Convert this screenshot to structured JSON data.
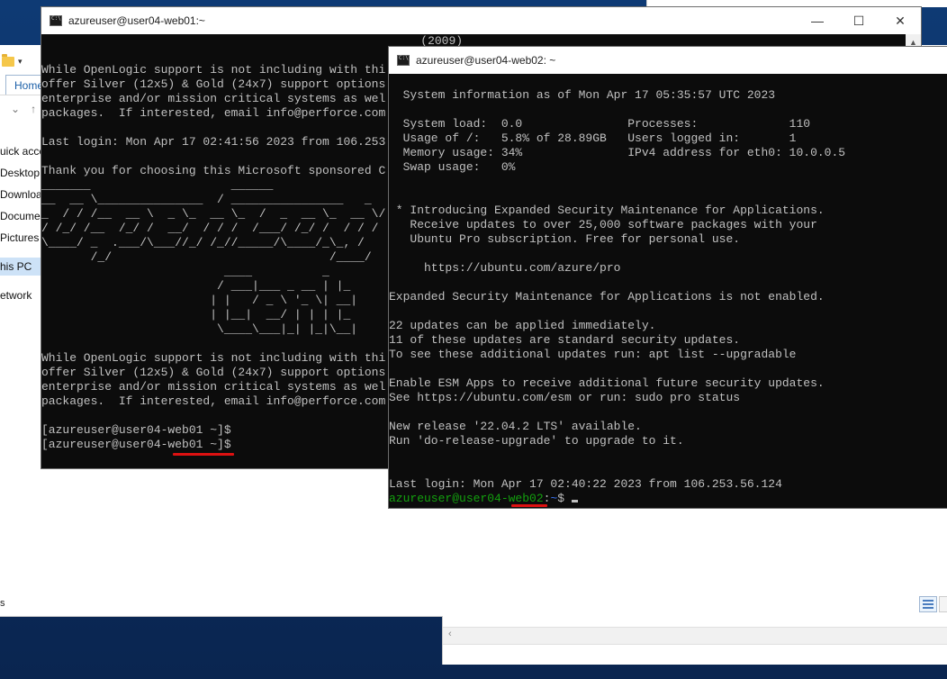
{
  "explorer": {
    "home_tab": "Home",
    "nav_items": [
      "uick acce",
      "Desktop",
      "Downloa",
      "Docume",
      "Pictures",
      "his PC",
      "etwork"
    ],
    "status_text": "s"
  },
  "web01": {
    "title": "azureuser@user04-web01:~",
    "lines": [
      "                                                      (2009)",
      "",
      "While OpenLogic support is not including with thi",
      "offer Silver (12x5) & Gold (24x7) support options",
      "enterprise and/or mission critical systems as wel",
      "packages.  If interested, email info@perforce.com",
      "",
      "Last login: Mon Apr 17 02:41:56 2023 from 106.253",
      "",
      "Thank you for choosing this Microsoft sponsored C",
      "_______                    ______               ",
      "__  __ \\_______________  / ________________   _",
      "_  / / /__  __ \\  _ \\_  __ \\_  /  _  __ \\_  __ \\/",
      "/ /_/ /__  /_/ /  __/  / / /  /___/ /_/ /  / / /",
      "\\____/ _  .___/\\___//_/ /_//_____/\\____/_\\_, /",
      "       /_/                               /____/ ",
      "                          ____          _     ",
      "                         / ___|___ _ __ | |_ ",
      "                        | |   / _ \\ '_ \\| __|",
      "                        | |__|  __/ | | | |_ ",
      "                         \\____\\___|_| |_|\\__|",
      "",
      "While OpenLogic support is not including with thi",
      "offer Silver (12x5) & Gold (24x7) support options",
      "enterprise and/or mission critical systems as wel",
      "packages.  If interested, email info@perforce.com",
      "",
      "[azureuser@user04-web01 ~]$",
      "[azureuser@user04-web01 ~]$"
    ]
  },
  "web02": {
    "title": "azureuser@user04-web02: ~",
    "lines": [
      "",
      "  System information as of Mon Apr 17 05:35:57 UTC 2023",
      "",
      "  System load:  0.0               Processes:             110",
      "  Usage of /:   5.8% of 28.89GB   Users logged in:       1",
      "  Memory usage: 34%               IPv4 address for eth0: 10.0.0.5",
      "  Swap usage:   0%",
      "",
      "",
      " * Introducing Expanded Security Maintenance for Applications.",
      "   Receive updates to over 25,000 software packages with your",
      "   Ubuntu Pro subscription. Free for personal use.",
      "",
      "     https://ubuntu.com/azure/pro",
      "",
      "Expanded Security Maintenance for Applications is not enabled.",
      "",
      "22 updates can be applied immediately.",
      "11 of these updates are standard security updates.",
      "To see these additional updates run: apt list --upgradable",
      "",
      "Enable ESM Apps to receive additional future security updates.",
      "See https://ubuntu.com/esm or run: sudo pro status",
      "",
      "New release '22.04.2 LTS' available.",
      "Run 'do-release-upgrade' to upgrade to it.",
      "",
      "",
      "Last login: Mon Apr 17 02:40:22 2023 from 106.253.56.124"
    ],
    "prompt_user": "azureuser@user04-web02",
    "prompt_sep": ":",
    "prompt_path": "~",
    "prompt_end": "$ "
  },
  "colors": {
    "terminal_bg": "#0c0c0c",
    "terminal_text": "#c0c0c0",
    "prompt_green": "#13a10e",
    "prompt_blue": "#3b78ff",
    "annotation_red": "#dd1111"
  }
}
